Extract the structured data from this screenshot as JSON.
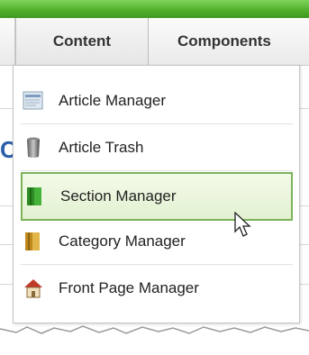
{
  "menubar": {
    "tabs": [
      {
        "label": "Content"
      },
      {
        "label": "Components"
      }
    ]
  },
  "page": {
    "partial_letter": "C"
  },
  "dropdown": {
    "items": [
      {
        "label": "Article Manager",
        "icon": "article-manager-icon"
      },
      {
        "label": "Article Trash",
        "icon": "trash-can-icon"
      },
      {
        "label": "Section Manager",
        "icon": "section-manager-icon",
        "hovered": true
      },
      {
        "label": "Category Manager",
        "icon": "category-manager-icon"
      },
      {
        "label": "Front Page Manager",
        "icon": "home-icon"
      }
    ]
  },
  "colors": {
    "topbar": "#4fae2b",
    "hover_border": "#7bb35a",
    "hover_bg": "#e3f1d1",
    "page_accent": "#2b5fa8"
  }
}
